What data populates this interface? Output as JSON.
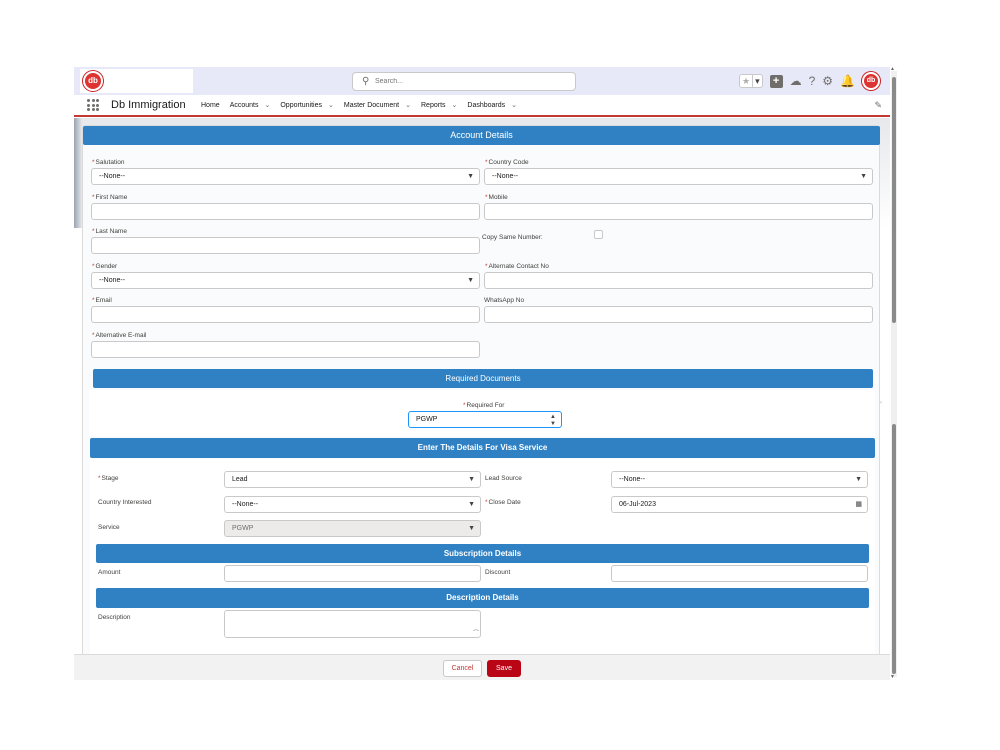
{
  "header": {
    "logo_text": "db",
    "search_placeholder": "Search...",
    "icons": [
      "star-icon",
      "chevron-down-icon",
      "add-icon",
      "trailhead-icon",
      "help-icon",
      "setup-gear-icon",
      "notification-bell-icon",
      "avatar"
    ]
  },
  "nav": {
    "app_name": "Db Immigration",
    "items": [
      {
        "label": "Home",
        "has_menu": false
      },
      {
        "label": "Accounts",
        "has_menu": true
      },
      {
        "label": "Opportunities",
        "has_menu": true
      },
      {
        "label": "Master Document",
        "has_menu": true
      },
      {
        "label": "Reports",
        "has_menu": true
      },
      {
        "label": "Dashboards",
        "has_menu": true
      }
    ]
  },
  "account": {
    "title": "Account Details",
    "salutation": {
      "label": "Salutation",
      "value": "--None--"
    },
    "country_code": {
      "label": "Country Code",
      "value": "--None--"
    },
    "first_name": {
      "label": "First Name",
      "value": ""
    },
    "mobile": {
      "label": "Mobile",
      "value": ""
    },
    "last_name": {
      "label": "Last Name",
      "value": ""
    },
    "copy_same_number": {
      "label": "Copy Same Number:",
      "checked": false
    },
    "gender": {
      "label": "Gender",
      "value": "--None--"
    },
    "alternate_contact": {
      "label": "Alternate Contact No",
      "value": ""
    },
    "email": {
      "label": "Email",
      "value": ""
    },
    "whatsapp": {
      "label": "WhatsApp No",
      "value": ""
    },
    "alt_email": {
      "label": "Alternative E-mail",
      "value": ""
    }
  },
  "documents": {
    "title": "Required Documents",
    "required_for": {
      "label": "Required For",
      "value": "PGWP"
    }
  },
  "visa": {
    "title": "Enter The Details For Visa Service",
    "stage": {
      "label": "Stage",
      "value": "Lead"
    },
    "lead_source": {
      "label": "Lead Source",
      "value": "--None--"
    },
    "country_interested": {
      "label": "Country Interested",
      "value": "--None--"
    },
    "close_date": {
      "label": "Close Date",
      "value": "06-Jul-2023"
    },
    "service": {
      "label": "Service",
      "value": "PGWP"
    }
  },
  "subscription": {
    "title": "Subscription Details",
    "amount": {
      "label": "Amount",
      "value": ""
    },
    "discount": {
      "label": "Discount",
      "value": ""
    }
  },
  "description": {
    "title": "Description Details",
    "label": "Description",
    "value": ""
  },
  "footer": {
    "cancel": "Cancel",
    "save": "Save"
  },
  "colors": {
    "section_blue": "#2f81c4",
    "brand_red": "#c23934",
    "save_red": "#ba0517"
  }
}
